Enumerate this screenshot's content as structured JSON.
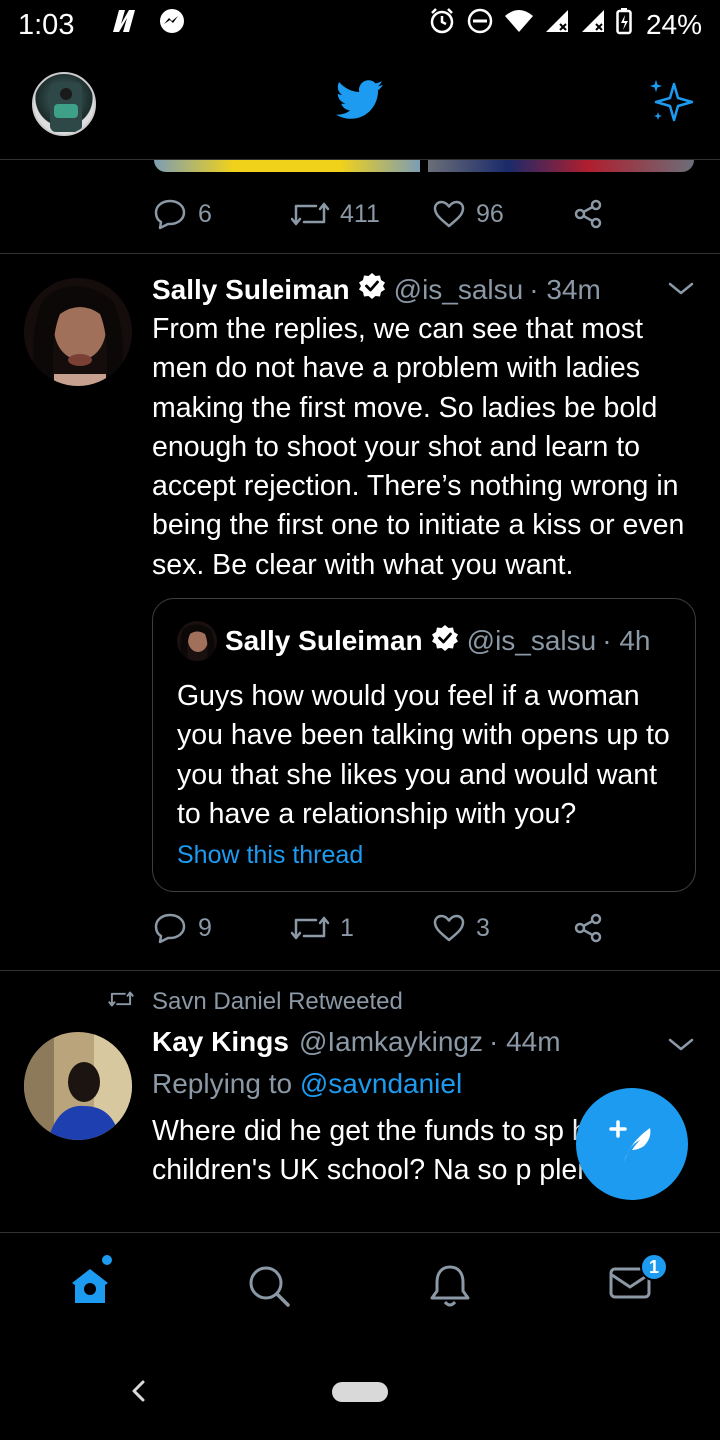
{
  "status_bar": {
    "time": "1:03",
    "battery": "24%"
  },
  "prev_tweet": {
    "replies": "6",
    "retweets": "411",
    "likes": "96"
  },
  "tweet1": {
    "name": "Sally Suleiman",
    "handle": "@is_salsu",
    "time": "· 34m",
    "text": "From the replies, we can see that most men do not have a problem with ladies making the first move. So ladies be bold enough to shoot your shot and learn to accept rejection. There’s nothing wrong in being the first one to initiate a kiss or even sex. Be clear with what you want.",
    "quote": {
      "name": "Sally Suleiman",
      "handle": "@is_salsu",
      "time": "· 4h",
      "text": "Guys how would you feel if a woman you have been talking with opens up to you that she likes you and would want to have a relationship with you?",
      "link": "Show this thread"
    },
    "replies": "9",
    "retweets": "1",
    "likes": "3"
  },
  "tweet2": {
    "retweeted_by": "Savn Daniel Retweeted",
    "name": "Kay Kings",
    "handle": "@Iamkaykingz",
    "time": "· 44m",
    "replying_prefix": "Replying to",
    "replying_mention": "@savndaniel",
    "text": "Where did he get the funds to sp his children's UK school? Na so p plenty?"
  },
  "bottom_nav": {
    "messages_badge": "1"
  },
  "colors": {
    "accent": "#1d9bf0",
    "secondary_text": "#8b98a5",
    "divider": "#2f3336"
  }
}
